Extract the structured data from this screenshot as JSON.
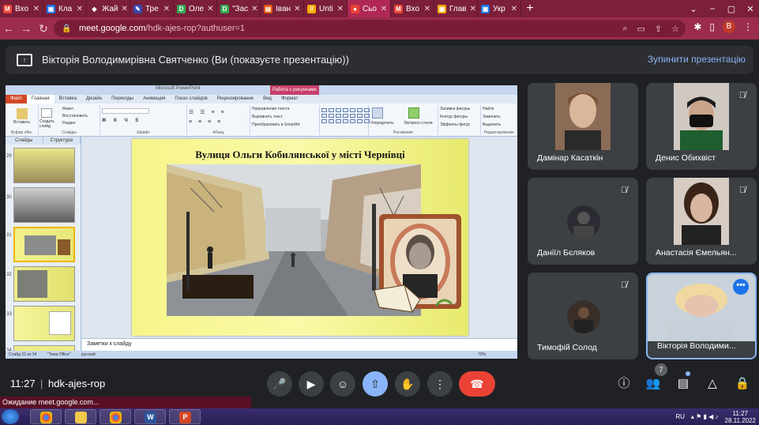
{
  "browser": {
    "tabs": [
      {
        "label": "Вхо",
        "fav": "M",
        "color": "#ea4335"
      },
      {
        "label": "Кла",
        "fav": "▣",
        "color": "#1a73e8"
      },
      {
        "label": "Жай",
        "fav": "◆",
        "color": "#7b1f3a"
      },
      {
        "label": "Тре",
        "fav": "✎",
        "color": "#3949ab"
      },
      {
        "label": "Оле",
        "fav": "D",
        "color": "#34a853"
      },
      {
        "label": "\"Зас",
        "fav": "D",
        "color": "#34a853"
      },
      {
        "label": "Іван",
        "fav": "▤",
        "color": "#e65100"
      },
      {
        "label": "Unti",
        "fav": "//",
        "color": "#f9ab00"
      },
      {
        "label": "Сьо",
        "fav": "●",
        "color": "#ea4335"
      },
      {
        "label": "Вхо",
        "fav": "M",
        "color": "#ea4335"
      },
      {
        "label": "Глав",
        "fav": "▣",
        "color": "#f9ab00"
      },
      {
        "label": "Укр",
        "fav": "▣",
        "color": "#1a73e8"
      }
    ],
    "url_host": "meet.google.com",
    "url_path": "/hdk-ajes-rop?authuser=1",
    "profile_initial": "B"
  },
  "banner": {
    "text": "Вікторія Володимирівна Святченко (Ви (показуєте презентацію))",
    "stop_label": "Зупинити презентацію"
  },
  "ppt": {
    "window_title": "Microsoft PowerPoint",
    "context_tab": "Работа с рисунками",
    "tabs": [
      "Файл",
      "Главная",
      "Вставка",
      "Дизайн",
      "Переходы",
      "Анимация",
      "Показ слайдов",
      "Рецензирование",
      "Вид",
      "Формат"
    ],
    "groups": {
      "clipboard": "Буфер обм.",
      "slides": "Слайды",
      "font": "Шрифт",
      "paragraph": "Абзац",
      "drawing": "Рисование",
      "editing": "Редактирование"
    },
    "ribbon_labels": {
      "paste": "Вставить",
      "create_slide": "Создать слайд",
      "layout": "Макет",
      "reset": "Восстановить",
      "section": "Раздел",
      "text_direction": "Направление текста",
      "align_text": "Выровнять текст",
      "smartart": "Преобразовать в SmartArt",
      "arrange": "Упорядочить",
      "quick_styles": "Экспресс-стили",
      "shape_fill": "Заливка фигуры",
      "shape_outline": "Контур фигуры",
      "shape_effects": "Эффекты фигур",
      "find": "Найти",
      "replace": "Заменить",
      "select": "Выделить"
    },
    "panel_tabs": [
      "Слайды",
      "Структура"
    ],
    "thumb_numbers": [
      "29",
      "30",
      "31",
      "32",
      "33",
      "34"
    ],
    "slide_title": "Вулиця Ольги Кобилянської у місті Чернівці",
    "notes_placeholder": "Заметки к слайду",
    "status_left": "Слайд 31 из 34",
    "status_theme": "\"Тема Office\"",
    "status_lang": "русский",
    "status_zoom": "70%"
  },
  "participants": [
    {
      "name": "Дамінар Касаткін",
      "muted": false
    },
    {
      "name": "Денис Обихвіст",
      "muted": true
    },
    {
      "name": "Даніїл Бєляков",
      "muted": true
    },
    {
      "name": "Анастасія Ємельян...",
      "muted": true
    },
    {
      "name": "Тимофій Солод",
      "muted": true
    },
    {
      "name": "Вікторія Володими...",
      "muted": false
    }
  ],
  "meet": {
    "time": "11:27",
    "separator": "|",
    "code": "hdk-ajes-rop",
    "people_count": "7"
  },
  "status_text": "Ожидание meet.google.com...",
  "taskbar": {
    "lang": "RU",
    "time": "11:27",
    "date": "28.11.2022"
  }
}
